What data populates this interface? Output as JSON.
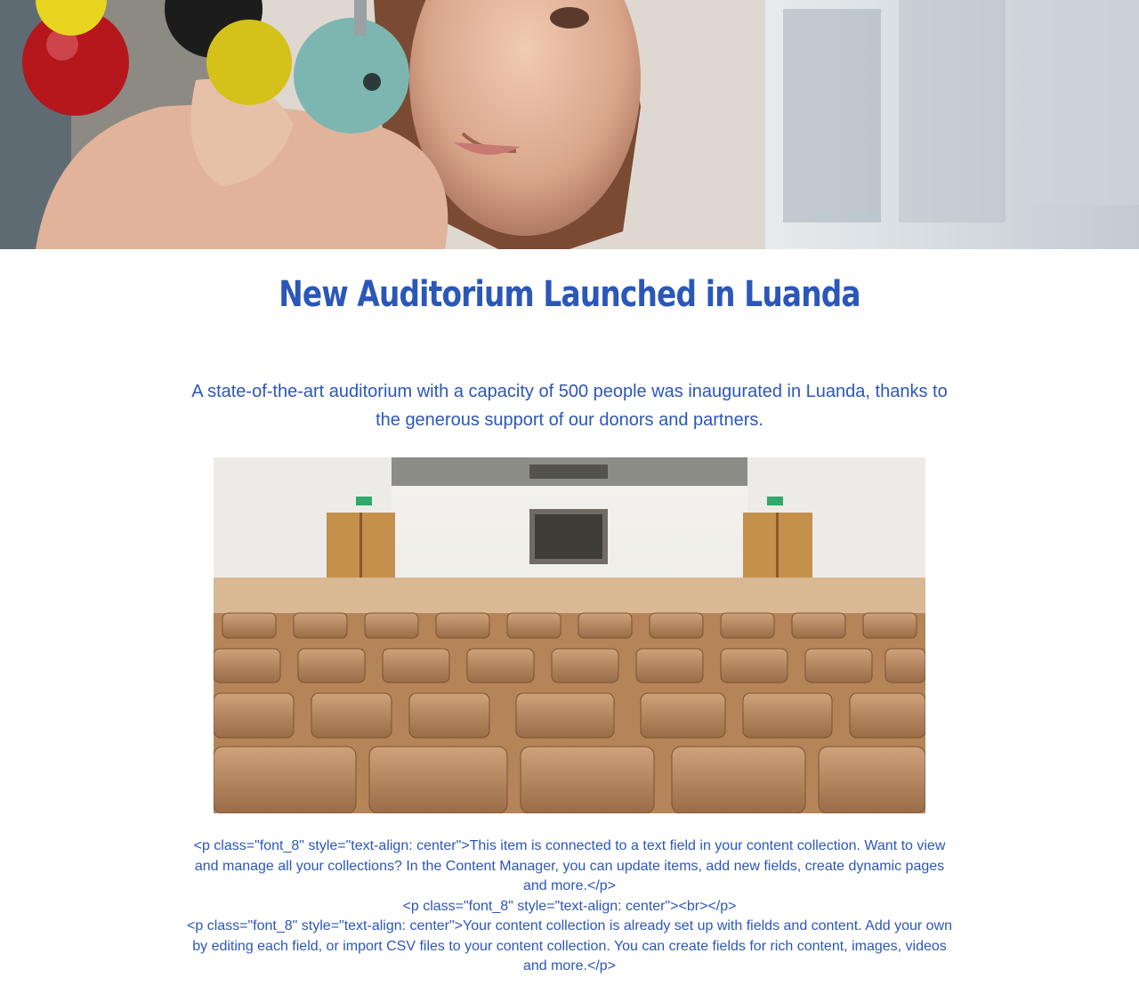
{
  "article": {
    "title": "New Auditorium Launched in Luanda",
    "lead": "A state-of-the-art auditorium with a capacity of 500 people was inaugurated in Luanda, thanks to the generous support of our donors and partners.",
    "body_lines": [
      "<p class=\"font_8\" style=\"text-align: center\">This item is connected to a text field in your content collection. Want to view and manage all your collections? In the Content Manager, you can update items, add new fields, create dynamic pages and more.</p>",
      "<p class=\"font_8\" style=\"text-align: center\"><br></p>",
      "<p class=\"font_8\" style=\"text-align: center\">Your content collection is already set up with fields and content. Add your own by editing each field, or import CSV files to your content collection. You can create fields for rich content, images, videos and more.</p>"
    ]
  },
  "colors": {
    "accent": "#2b57b9",
    "background": "#ffffff"
  }
}
